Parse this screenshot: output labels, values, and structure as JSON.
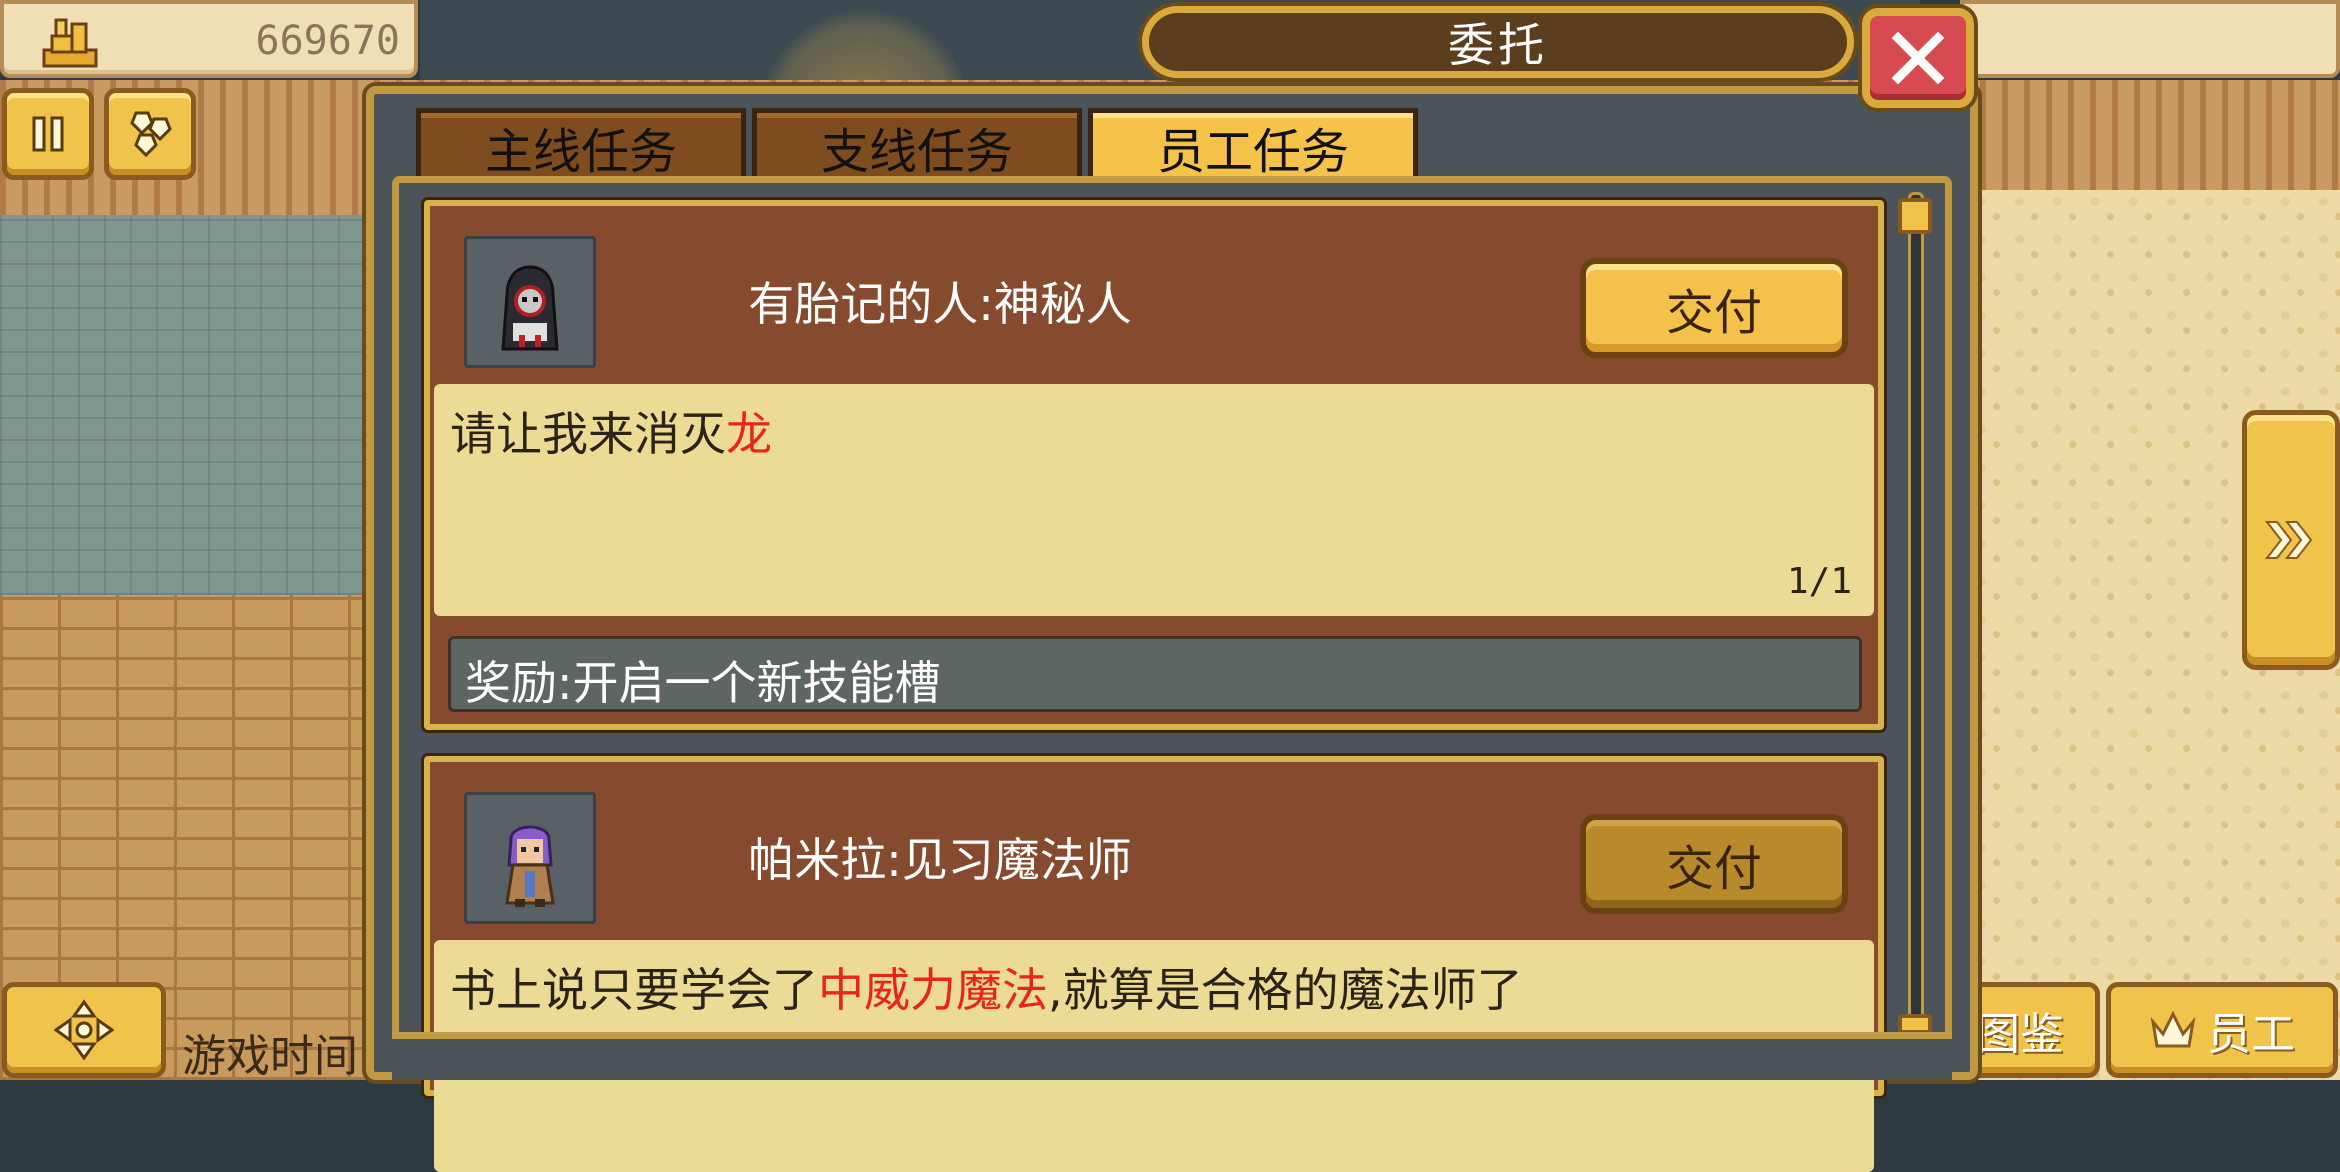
{
  "hud": {
    "gold_amount": "669670",
    "game_time_label": "游戏时间",
    "codex_label": "图鉴",
    "staff_label": "员工"
  },
  "dialog": {
    "title": "委托",
    "tabs": [
      {
        "label": "主线任务",
        "active": false
      },
      {
        "label": "支线任务",
        "active": false
      },
      {
        "label": "员工任务",
        "active": true
      }
    ]
  },
  "quests": [
    {
      "title": "有胎记的人:神秘人",
      "deliver_label": "交付",
      "deliver_enabled": true,
      "desc_prefix": "请让我来消灭",
      "desc_highlight": "龙",
      "desc_suffix": "",
      "progress": "1/1",
      "reward": "奖励:开启一个新技能槽"
    },
    {
      "title": "帕米拉:见习魔法师",
      "deliver_label": "交付",
      "deliver_enabled": false,
      "desc_prefix": "书上说只要学会了",
      "desc_highlight": "中威力魔法",
      "desc_suffix": ",就算是合格的魔法师了"
    }
  ],
  "colors": {
    "highlight": "#e8241c",
    "tab_active": "#f6c34a",
    "tab_inactive": "#7e4c1e",
    "card_bg": "#864b2e",
    "desc_bg": "#ecdb95",
    "close_red": "#d84a52"
  },
  "icons": {
    "gold": "gold-stack-icon",
    "pause": "pause-icon",
    "gems": "gems-icon",
    "close": "close-x-icon",
    "move": "dpad-icon",
    "codex": "book-icon",
    "staff": "crown-icon",
    "next": "chevron-right-icon"
  }
}
